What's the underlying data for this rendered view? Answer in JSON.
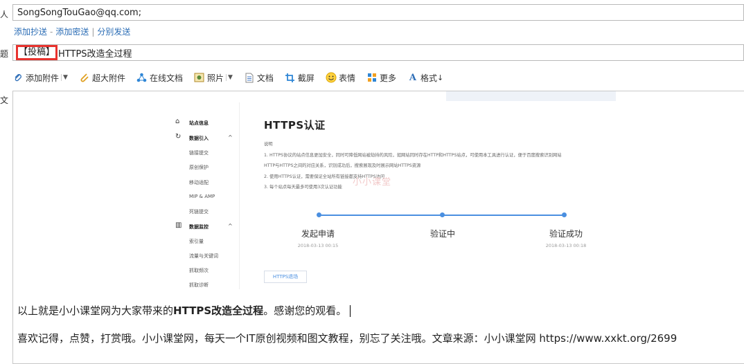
{
  "labels": {
    "to_suffix": "人",
    "subject_suffix": "题",
    "body_suffix": "文"
  },
  "recipient": {
    "value": "SongSongTouGao@qq.com;"
  },
  "links": {
    "add_cc": "添加抄送",
    "dash": "-",
    "add_bcc": "添加密送",
    "bar": "|",
    "separate_send": "分别发送"
  },
  "subject": {
    "tag": "【投稿】",
    "text": "HTTPS改造全过程"
  },
  "toolbar": {
    "add_attachment": "添加附件",
    "large_attachment": "超大附件",
    "online_doc": "在线文档",
    "photo": "照片",
    "document": "文档",
    "screenshot": "截屏",
    "emoji": "表情",
    "more": "更多",
    "format": "格式"
  },
  "embedded": {
    "nav": {
      "site_info": "站点信息",
      "data_import": "数据引入",
      "link_submit": "链接提交",
      "original_protect": "原创保护",
      "mobile_adapt": "移动适配",
      "mip_amp": "MIP & AMP",
      "dead_link": "死链提交",
      "data_monitor": "数据监控",
      "index_volume": "索引量",
      "traffic_keywords": "流量与关键词",
      "crawl_freq": "抓取频次",
      "crawl_diag": "抓取诊断"
    },
    "title": "HTTPS认证",
    "desc_label": "说明",
    "desc1": "1. HTTPS协议的站点信息更加安全，同时可降低网站被劫持的风险，如网站同时存在HTTP和HTTPS站点，可使用本工具进行认证，便于百度搜索识别网站",
    "desc1b": "HTTP与HTTPS之间的对应关系，识别成功后，搜索展现及时展示网站HTTPS资源",
    "desc2": "2. 使用HTTPS认证，需要保证全站所有链接都支持HTTPS访问",
    "desc3": "3. 每个站点每天最多可使用3次认证功能",
    "watermark": "小小课堂",
    "steps": [
      {
        "label": "发起申请",
        "date": "2018-03-13 00:15"
      },
      {
        "label": "验证中",
        "date": ""
      },
      {
        "label": "验证成功",
        "date": "2018-03-13 00:18"
      }
    ],
    "button": "HTTPS退场"
  },
  "body": {
    "line1_pre": "以上就是小小课堂网为大家带来的",
    "line1_bold": "HTTPS改造全过程",
    "line1_post": "。感谢您的观看。",
    "line2": "喜欢记得，点赞，打赏哦。小小课堂网，每天一个IT原创视频和图文教程，别忘了关注哦。文章来源：小小课堂网 https://www.xxkt.org/2699"
  },
  "colors": {
    "link": "#2a6cb5",
    "highlight_box": "#e8322e",
    "progress": "#4a8fe0"
  }
}
